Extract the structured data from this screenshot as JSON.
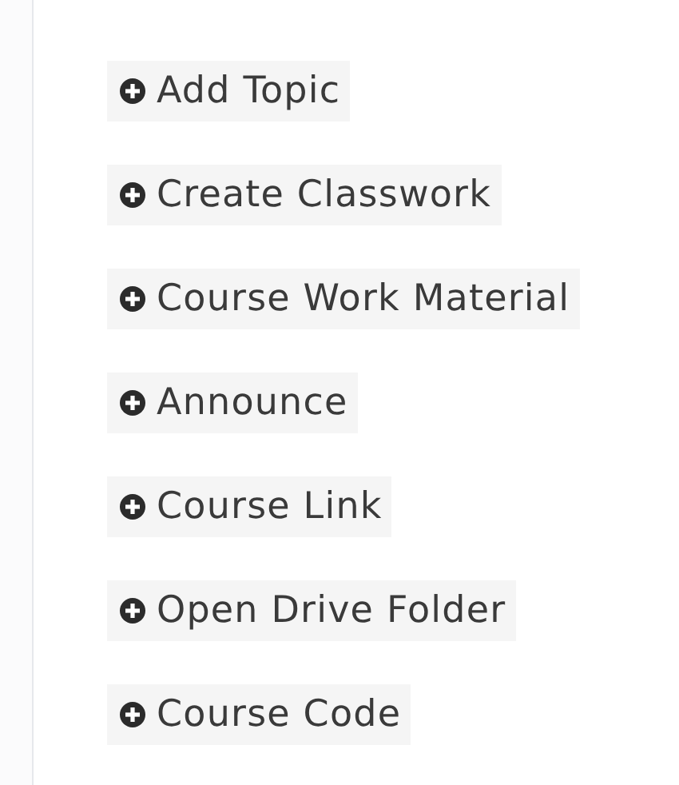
{
  "menu": {
    "items": [
      {
        "label": "Add Topic"
      },
      {
        "label": "Create Classwork"
      },
      {
        "label": "Course Work Material"
      },
      {
        "label": "Announce"
      },
      {
        "label": "Course Link"
      },
      {
        "label": "Open Drive Folder"
      },
      {
        "label": "Course Code"
      }
    ]
  }
}
